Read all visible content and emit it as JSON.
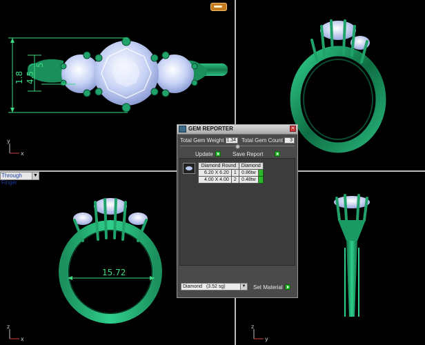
{
  "viewports": {
    "top_left": {
      "dim_height": "1.8",
      "dim_width_small": "5",
      "dim_second": "4.5",
      "axis_x": "x",
      "axis_y": "y"
    },
    "top_right": {},
    "bottom_left": {
      "view_mode": "Through Finger",
      "dim_inner": "15.72",
      "axis_x": "x",
      "axis_y": "z"
    },
    "bottom_right": {
      "axis_x": "y",
      "axis_y": "z"
    }
  },
  "gem_reporter": {
    "title": "GEM REPORTER",
    "total_weight_label": "Total Gem Weight",
    "total_weight_value": "1.34",
    "total_count_label": "Total Gem Count",
    "total_count_value": "3",
    "update_label": "Update",
    "save_report_label": "Save Report",
    "table": {
      "headers": [
        "Diamond Round",
        "",
        "Diamond"
      ],
      "rows": [
        {
          "size": "6.20 X 6.20",
          "count": "1",
          "weight": "0.86tw"
        },
        {
          "size": "4.00 X 4.00",
          "count": "2",
          "weight": "0.48tw"
        }
      ]
    },
    "material_select": "Diamond",
    "material_sg": "(3.52 sg)",
    "set_material_label": "Set Material"
  },
  "colors": {
    "ring_green": "#1f9e6b",
    "gem_blue": "#c6d2f5",
    "dim_green": "#3ddc84",
    "panel_bg": "#4a4a4a"
  }
}
